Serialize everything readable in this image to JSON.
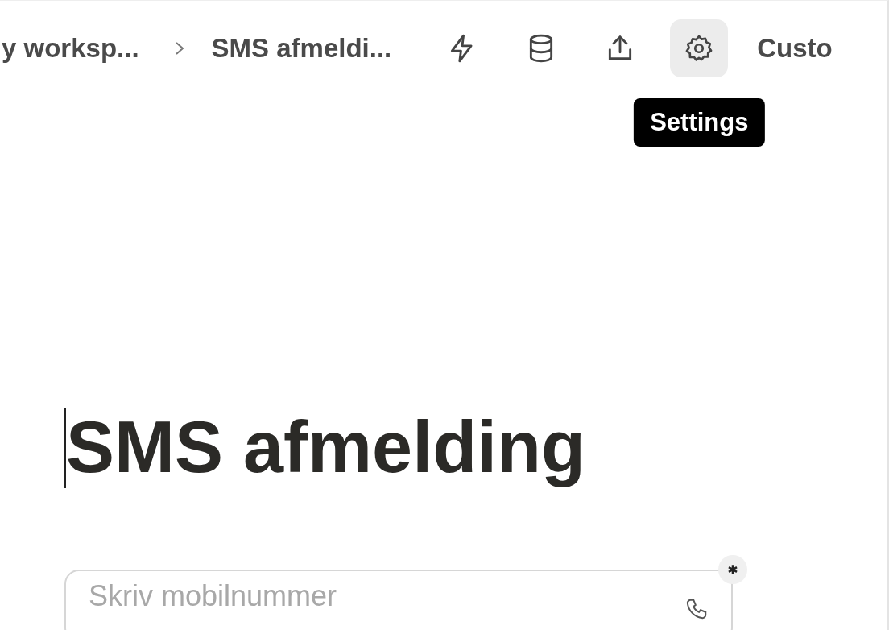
{
  "breadcrumb": [
    {
      "label": "y worksp..."
    },
    {
      "label": "SMS afmeldi..."
    }
  ],
  "toolbar": [
    {
      "kind": "bolt",
      "selected": false
    },
    {
      "kind": "database",
      "selected": false
    },
    {
      "kind": "share",
      "selected": false
    },
    {
      "kind": "gear",
      "selected": true
    }
  ],
  "tooltip": "Settings",
  "customize_label": "Custo",
  "title": "SMS afmelding",
  "phone_field": {
    "placeholder": "Skriv mobilnummer",
    "required": true
  }
}
